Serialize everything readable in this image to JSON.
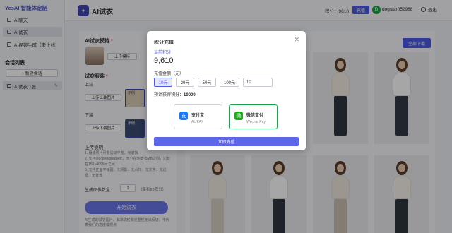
{
  "app": {
    "brand": "YesAI 智能体定制"
  },
  "sidebar": {
    "items": [
      {
        "label": "AI聊天",
        "icon": "chat-icon"
      },
      {
        "label": "AI试衣",
        "icon": "shirt-icon"
      },
      {
        "label": "AI视频生成（未上线）",
        "icon": "video-icon"
      }
    ],
    "section_title": "会话列表",
    "new_chat_label": "+ 新建会话",
    "chats": [
      {
        "label": "AI试衣 1张"
      }
    ]
  },
  "header": {
    "title": "AI试衣",
    "points_text": "积分：9610",
    "recharge_label": "充值",
    "avatar_letter": "D",
    "username": "dogstar052988",
    "logout_label": "退出"
  },
  "form": {
    "model_label": "AI试衣模特",
    "model_upload": "上传模特",
    "clothing_label": "试穿服装",
    "top_label": "上装",
    "top_upload": "上传上装图片",
    "bottom_label": "下装",
    "bottom_upload": "上传下装图片",
    "example_label": "示例",
    "desc_title": "上传说明",
    "desc_lines": [
      "1. 服装照片尽量清晰平整、无遮挡",
      "2. 支持jpg/jpeg/png/heic，大小在5KB~5MB之间，边长在150~4096px之间",
      "3. 支持正面平铺图、无阴影、无水印、无文字、无边框、无背景"
    ],
    "count_label": "生成图像数量：",
    "count_value": "1",
    "cost_text": "（每张20积分）",
    "start_label": "开始试衣",
    "footnote": "AI生成的试衣图片，其准确性和完整性无法保证，不代表我们的态度或观点"
  },
  "results": {
    "download_label": "全部下载"
  },
  "modal": {
    "title": "积分充值",
    "close_glyph": "✕",
    "current_label": "当前积分",
    "current_points": "9,610",
    "amount_label": "充值金额（元）",
    "amounts": [
      "10元",
      "20元",
      "50元",
      "100元"
    ],
    "custom_amount": "10",
    "expected_label": "预计获得积分：",
    "expected_value": "10000",
    "payments": [
      {
        "name": "支付宝",
        "sub": "ALIPAY",
        "icon": "alipay-icon",
        "color": "#1677ff",
        "glyph": "支"
      },
      {
        "name": "微信支付",
        "sub": "Wechat Pay",
        "icon": "wechat-pay-icon",
        "color": "#1aad19",
        "glyph": "微"
      }
    ],
    "confirm_label": "立即充值"
  },
  "colors": {
    "accent": "#4c59e6",
    "wechat_green": "#1aa34a",
    "alipay_blue": "#1677ff"
  }
}
